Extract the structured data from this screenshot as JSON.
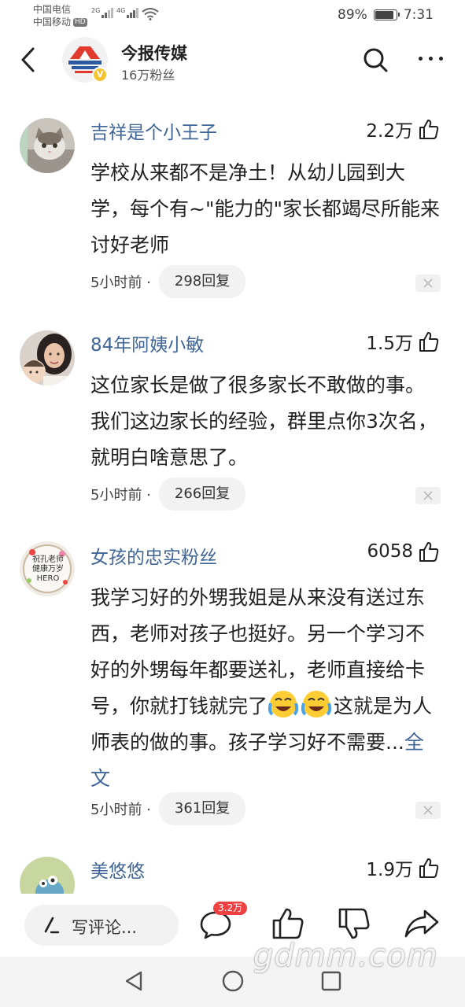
{
  "status": {
    "carrier1": "中国电信",
    "carrier2": "中国移动",
    "hd": "HD",
    "net1": "2G",
    "net2": "4G",
    "battery_pct": "89%",
    "battery_level": 0.89,
    "time": "7:31"
  },
  "header": {
    "account_name": "今报传媒",
    "fans": "16万粉丝",
    "verified_mark": "V"
  },
  "comments": [
    {
      "author": "吉祥是个小王子",
      "likes": "2.2万",
      "text": "学校从来都不是净土！从幼儿园到大学，每个有~\"能力的\"家长都竭尽所能来讨好老师",
      "time": "5小时前 ·",
      "replies": "298回复"
    },
    {
      "author": "84年阿姨小敏",
      "likes": "1.5万",
      "text": "这位家长是做了很多家长不敢做的事。我们这边家长的经验，群里点你3次名，就明白啥意思了。",
      "time": "5小时前 ·",
      "replies": "266回复"
    },
    {
      "author": "女孩的忠实粉丝",
      "likes": "6058",
      "text_before_emoji": "我学习好的外甥我姐是从来没有送过东西，老师对孩子也挺好。另一个学习不好的外甥每年都要送礼，老师直接给卡号，你就打钱就完了",
      "text_after_emoji": "这就是为人师表的做的事。孩子学习好不需要...",
      "more_link": "全文",
      "time": "5小时前 ·",
      "replies": "361回复",
      "avatar_text": "祝孔老师 健康万岁 HERO"
    },
    {
      "author": "美悠悠",
      "likes": "1.9万"
    }
  ],
  "toolbar": {
    "write_placeholder": "写评论...",
    "comment_count": "3.2万"
  },
  "watermark": "gdmm.com",
  "colors": {
    "name_blue": "#406599",
    "badge_red": "#f04142",
    "verified_yellow": "#f4c430"
  }
}
